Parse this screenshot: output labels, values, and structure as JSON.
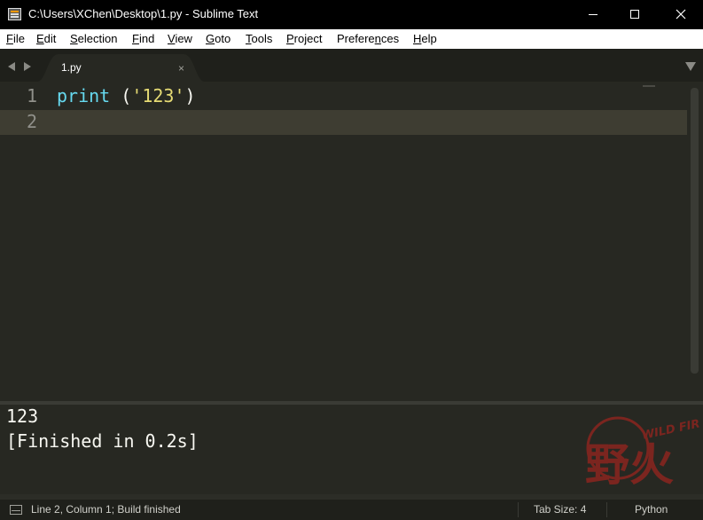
{
  "window": {
    "title": "C:\\Users\\XChen\\Desktop\\1.py - Sublime Text"
  },
  "menu": {
    "items": [
      {
        "accel": "F",
        "rest": "ile"
      },
      {
        "accel": "E",
        "rest": "dit"
      },
      {
        "accel": "S",
        "rest": "election"
      },
      {
        "accel": "F",
        "rest": "ind",
        "pre": ""
      },
      {
        "accel": "V",
        "rest": "iew"
      },
      {
        "accel": "G",
        "rest": "oto"
      },
      {
        "accel": "T",
        "rest": "ools"
      },
      {
        "accel": "P",
        "rest": "roject"
      },
      {
        "pre": "Prefere",
        "accel": "n",
        "rest": "ces"
      },
      {
        "accel": "H",
        "rest": "elp"
      }
    ]
  },
  "tabs": {
    "active": {
      "label": "1.py",
      "close": "×"
    }
  },
  "editor": {
    "line_numbers": [
      "1",
      "2"
    ],
    "code": {
      "line1_func": "print",
      "line1_space": " (",
      "line1_str": "'123'",
      "line1_close": ")"
    }
  },
  "output": {
    "lines": [
      "123",
      "[Finished in 0.2s]"
    ]
  },
  "watermark": {
    "text_main": "野火",
    "text_en": "WILD FIRE"
  },
  "status": {
    "position": "Line 2, Column 1; Build finished",
    "tab_size": "Tab Size: 4",
    "syntax": "Python"
  },
  "colors": {
    "func": "#66d9ef",
    "string": "#e6db74",
    "background": "#272822",
    "watermark": "#c0231e"
  }
}
